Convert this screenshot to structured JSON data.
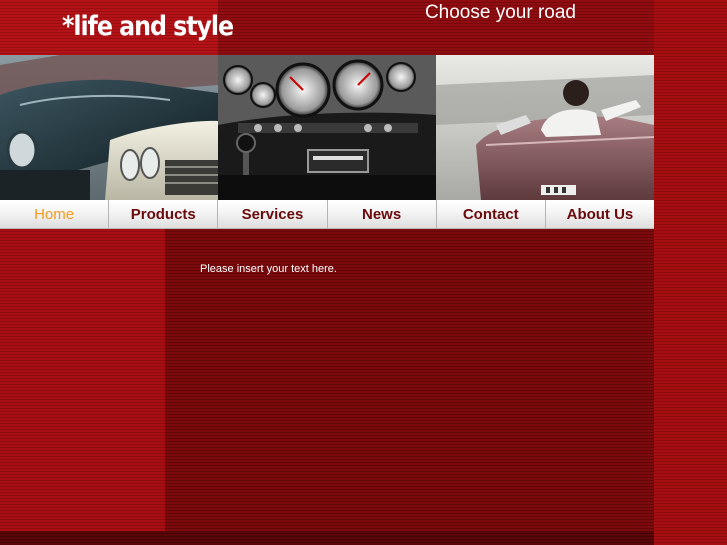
{
  "site": {
    "logo_text": "*life and style",
    "tagline": "Choose your road"
  },
  "banner": {
    "photos": [
      "vintage-cars-photo",
      "dashboard-gauges-photo",
      "convertible-driver-photo"
    ]
  },
  "nav": {
    "items": [
      {
        "label": "Home",
        "active": true
      },
      {
        "label": "Products",
        "active": false
      },
      {
        "label": "Services",
        "active": false
      },
      {
        "label": "News",
        "active": false
      },
      {
        "label": "Contact",
        "active": false
      },
      {
        "label": "About Us",
        "active": false
      }
    ]
  },
  "main": {
    "text": "Please insert your text here."
  },
  "colors": {
    "background_red": "#a50f12",
    "content_dark_red": "#7b0a0d",
    "nav_text": "#6a0a0c",
    "nav_active": "#f39a1c"
  }
}
